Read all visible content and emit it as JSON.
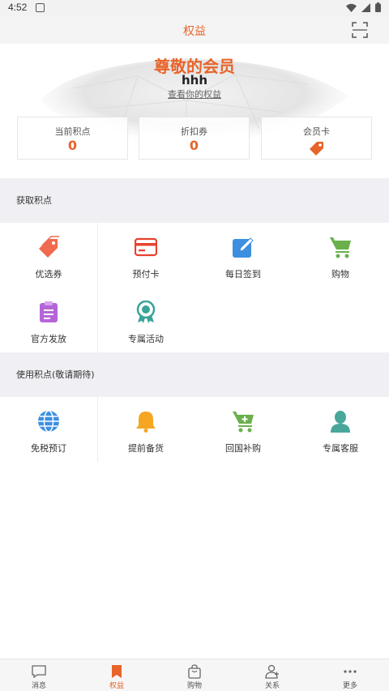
{
  "status_bar": {
    "time": "4:52"
  },
  "header": {
    "title": "权益"
  },
  "hero": {
    "title": "尊敬的会员",
    "username": "hhh",
    "link_text": "查看你的权益"
  },
  "stats": [
    {
      "label": "当前积点",
      "value": "0"
    },
    {
      "label": "折扣券",
      "value": "0"
    },
    {
      "label": "会员卡",
      "icon": "tag-icon"
    }
  ],
  "earn": {
    "title": "获取积点",
    "items": [
      {
        "label": "优选券",
        "icon": "tag-icon"
      },
      {
        "label": "预付卡",
        "icon": "credit-card-icon"
      },
      {
        "label": "每日签到",
        "icon": "edit-icon"
      },
      {
        "label": "购物",
        "icon": "cart-icon"
      },
      {
        "label": "官方发放",
        "icon": "clipboard-icon"
      },
      {
        "label": "专属活动",
        "icon": "award-icon"
      }
    ]
  },
  "use": {
    "title": "使用积点(敬请期待)",
    "items": [
      {
        "label": "免税预订",
        "icon": "globe-icon"
      },
      {
        "label": "提前备货",
        "icon": "bell-icon"
      },
      {
        "label": "回国补购",
        "icon": "cart-plus-icon"
      },
      {
        "label": "专属客服",
        "icon": "person-icon"
      }
    ]
  },
  "bottom_nav": [
    {
      "label": "消息",
      "icon": "message-icon"
    },
    {
      "label": "权益",
      "icon": "bookmark-icon",
      "active": true
    },
    {
      "label": "购物",
      "icon": "bag-icon"
    },
    {
      "label": "关系",
      "icon": "relations-icon"
    },
    {
      "label": "更多",
      "icon": "more-icon"
    }
  ],
  "colors": {
    "accent": "#e8642a",
    "card_red": "#e8412e",
    "edit_blue": "#3d8fdf",
    "cart_green": "#6ab04c",
    "clipboard_purple": "#b565d8",
    "award_teal": "#3aa39a",
    "bell_orange": "#f5a623",
    "person_teal": "#4aa69a"
  }
}
